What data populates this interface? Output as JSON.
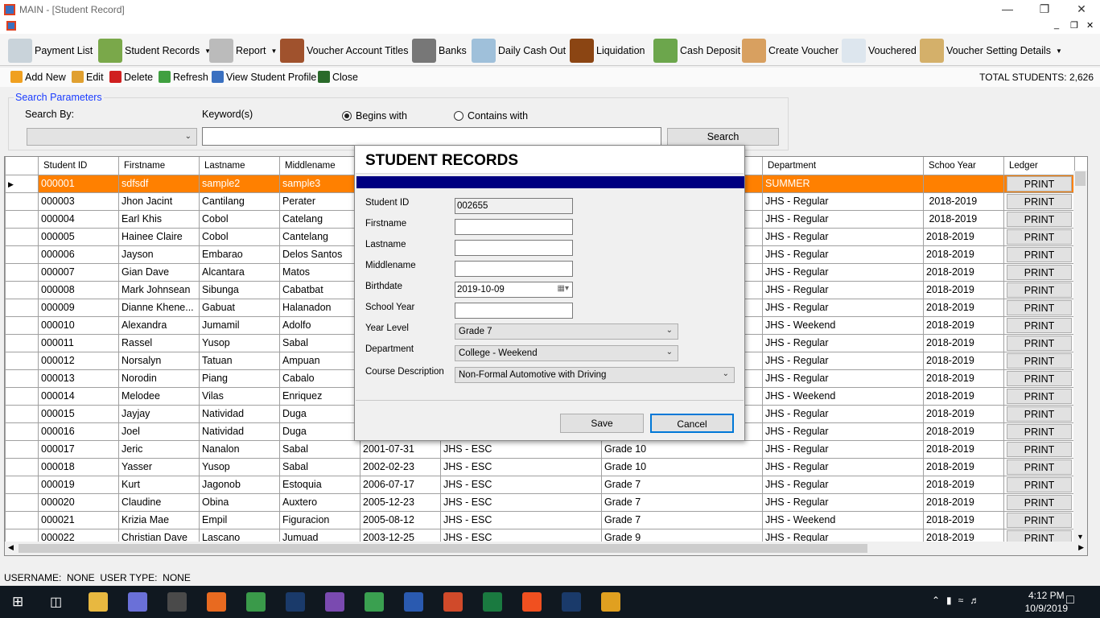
{
  "window": {
    "title": "MAIN - [Student Record]"
  },
  "toolbar": [
    {
      "label": "Payment List",
      "icon": "payment-list-icon",
      "color": "#c9d3da",
      "dropdown": false
    },
    {
      "label": "Student Records",
      "icon": "users-icon",
      "color": "#7aa84a",
      "dropdown": true
    },
    {
      "label": "Report",
      "icon": "printer-icon",
      "color": "#bbbbbb",
      "dropdown": true
    },
    {
      "label": "Voucher Account Titles",
      "icon": "notebook-icon",
      "color": "#a0522d",
      "dropdown": false
    },
    {
      "label": "Banks",
      "icon": "bank-icon",
      "color": "#777777",
      "dropdown": false
    },
    {
      "label": "Daily Cash Out",
      "icon": "spreadsheet-cash-icon",
      "color": "#9fc0da",
      "dropdown": false
    },
    {
      "label": "Liquidation",
      "icon": "abacus-icon",
      "color": "#8b4513",
      "dropdown": false
    },
    {
      "label": "Cash Deposit",
      "icon": "dollar-icon",
      "color": "#6ca64c",
      "dropdown": false
    },
    {
      "label": "Create Voucher",
      "icon": "pencil-paper-icon",
      "color": "#d8a060",
      "dropdown": false
    },
    {
      "label": "Vouchered",
      "icon": "receipt-icon",
      "color": "#dde6ee",
      "dropdown": false
    },
    {
      "label": "Voucher Setting Details",
      "icon": "folder-box-icon",
      "color": "#d4b06a",
      "dropdown": true
    }
  ],
  "actions": [
    {
      "label": "Add New",
      "icon": "add-new-icon",
      "color": "#f0a020"
    },
    {
      "label": "Edit",
      "icon": "pencil-icon",
      "color": "#e0a030"
    },
    {
      "label": "Delete",
      "icon": "delete-icon",
      "color": "#d02020"
    },
    {
      "label": "Refresh",
      "icon": "refresh-icon",
      "color": "#40a040"
    },
    {
      "label": "View Student Profile",
      "icon": "user-profile-icon",
      "color": "#3a70c0"
    },
    {
      "label": "Close",
      "icon": "exit-door-icon",
      "color": "#2a6a2a"
    }
  ],
  "total_students": "TOTAL STUDENTS: 2,626",
  "search": {
    "group_label": "Search Parameters",
    "search_by_label": "Search By:",
    "search_by_value": "",
    "keyword_label": "Keyword(s)",
    "keyword_value": "",
    "begins_with": "Begins with",
    "contains_with": "Contains with",
    "selected_mode": "begins",
    "search_button": "Search"
  },
  "grid": {
    "headers": [
      "Student ID",
      "Firstname",
      "Lastname",
      "Middlename",
      "",
      "",
      "",
      "Department",
      "Schoo Year",
      "Ledger"
    ],
    "print_label": "PRINT",
    "rows": [
      [
        "000001",
        "sdfsdf",
        "sample2",
        "sample3",
        "",
        "",
        "",
        "SUMMER",
        ""
      ],
      [
        "000003",
        "Jhon Jacint",
        "Cantilang",
        "Perater",
        "",
        "",
        "",
        "JHS - Regular",
        " 2018-2019"
      ],
      [
        "000004",
        "Earl Khis",
        "Cobol",
        "Catelang",
        "",
        "",
        "",
        "JHS - Regular",
        " 2018-2019"
      ],
      [
        "000005",
        "Hainee Claire",
        "Cobol",
        "Cantelang",
        "",
        "",
        "",
        "JHS - Regular",
        "2018-2019"
      ],
      [
        "000006",
        "Jayson",
        "Embarao",
        "Delos Santos",
        "",
        "",
        "",
        "JHS - Regular",
        "2018-2019"
      ],
      [
        "000007",
        "Gian Dave",
        "Alcantara",
        "Matos",
        "",
        "",
        "",
        "JHS - Regular",
        "2018-2019"
      ],
      [
        "000008",
        "Mark Johnsean",
        "Sibunga",
        "Cabatbat",
        "",
        "",
        "",
        "JHS - Regular",
        "2018-2019"
      ],
      [
        "000009",
        "Dianne Khene...",
        "Gabuat",
        "Halanadon",
        "",
        "",
        "",
        "JHS - Regular",
        "2018-2019"
      ],
      [
        "000010",
        "Alexandra",
        "Jumamil",
        "Adolfo",
        "",
        "",
        "",
        "JHS - Weekend",
        "2018-2019"
      ],
      [
        "000011",
        "Rassel",
        "Yusop",
        "Sabal",
        "",
        "",
        "",
        "JHS - Regular",
        "2018-2019"
      ],
      [
        "000012",
        "Norsalyn",
        "Tatuan",
        "Ampuan",
        "",
        "",
        "",
        "JHS - Regular",
        "2018-2019"
      ],
      [
        "000013",
        "Norodin",
        "Piang",
        "Cabalo",
        "",
        "",
        "",
        "JHS - Regular",
        "2018-2019"
      ],
      [
        "000014",
        "Melodee",
        "Vilas",
        "Enriquez",
        "",
        "",
        "",
        "JHS - Weekend",
        "2018-2019"
      ],
      [
        "000015",
        "Jayjay",
        "Natividad",
        "Duga",
        "",
        "",
        "",
        "JHS - Regular",
        "2018-2019"
      ],
      [
        "000016",
        "Joel",
        "Natividad",
        "Duga",
        "",
        "",
        "",
        "JHS - Regular",
        "2018-2019"
      ],
      [
        "000017",
        "Jeric",
        "Nanalon",
        "Sabal",
        "2001-07-31",
        "JHS - ESC",
        "Grade 10",
        "JHS - Regular",
        "2018-2019"
      ],
      [
        "000018",
        "Yasser",
        "Yusop",
        "Sabal",
        "2002-02-23",
        "JHS - ESC",
        "Grade 10",
        "JHS - Regular",
        "2018-2019"
      ],
      [
        "000019",
        "Kurt",
        "Jagonob",
        "Estoquia",
        "2006-07-17",
        "JHS - ESC",
        "Grade 7",
        "JHS - Regular",
        "2018-2019"
      ],
      [
        "000020",
        "Claudine",
        "Obina",
        "Auxtero",
        "2005-12-23",
        "JHS - ESC",
        "Grade 7",
        "JHS - Regular",
        "2018-2019"
      ],
      [
        "000021",
        "Krizia Mae",
        "Empil",
        "Figuracion",
        "2005-08-12",
        "JHS - ESC",
        "Grade 7",
        "JHS - Weekend",
        "2018-2019"
      ],
      [
        "000022",
        "Christian Dave",
        "Lascano",
        "Jumuad",
        "2003-12-25",
        "JHS - ESC",
        "Grade 9",
        "JHS - Regular",
        "2018-2019"
      ]
    ],
    "selected_color": "#ff8000"
  },
  "dialog": {
    "title": "STUDENT RECORDS",
    "band_color": "#000080",
    "student_id_label": "Student ID",
    "student_id": "002655",
    "firstname_label": "Firstname",
    "firstname": "",
    "lastname_label": "Lastname",
    "lastname": "",
    "middlename_label": "Middlename",
    "middlename": "",
    "birthdate_label": "Birthdate",
    "birthdate": "2019-10-09",
    "school_year_label": "School Year",
    "school_year": "",
    "year_level_label": "Year Level",
    "year_level": "Grade 7",
    "department_label": "Department",
    "department": "College - Weekend",
    "course_label": "Course Description",
    "course": "Non-Formal Automotive with Driving",
    "save": "Save",
    "cancel": "Cancel"
  },
  "status": {
    "text": "USERNAME:  NONE  USER TYPE:  NONE"
  },
  "taskbar": {
    "time": "4:12 PM",
    "date": "10/9/2019",
    "apps": [
      {
        "icon": "file-explorer-icon",
        "color": "#e8b840"
      },
      {
        "icon": "infinity-app-icon",
        "color": "#6a70d8"
      },
      {
        "icon": "sublime-text-icon",
        "color": "#4a4a4a"
      },
      {
        "icon": "firefox-icon",
        "color": "#e86a20"
      },
      {
        "icon": "chrome-icon",
        "color": "#3a9a4a"
      },
      {
        "icon": "photoshop-icon",
        "color": "#1a3a6a"
      },
      {
        "icon": "tor-browser-icon",
        "color": "#7a4ab0"
      },
      {
        "icon": "globe-app-icon",
        "color": "#3aa050"
      },
      {
        "icon": "word-icon",
        "color": "#2a5ab0"
      },
      {
        "icon": "powerpoint-icon",
        "color": "#d04a2a"
      },
      {
        "icon": "excel-icon",
        "color": "#1a7a40"
      },
      {
        "icon": "brave-icon",
        "color": "#f05020"
      },
      {
        "icon": "photoshop-icon-2",
        "color": "#1a3a6a"
      },
      {
        "icon": "running-app-icon",
        "color": "#e0a020"
      }
    ]
  }
}
